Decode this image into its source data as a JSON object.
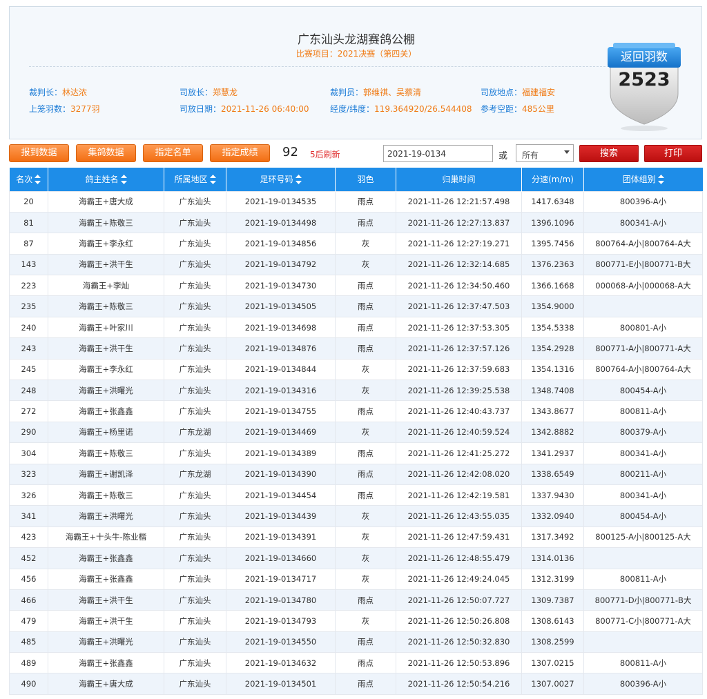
{
  "header": {
    "club_name": "广东汕头龙湖赛鸽公棚",
    "race_label": "比赛项目：",
    "race_value": "2021决赛（第四关）",
    "info": [
      {
        "label": "裁判长：",
        "value": "林达浓"
      },
      {
        "label": "司放长：",
        "value": "郑慧龙"
      },
      {
        "label": "裁判员：",
        "value": "郭维祺、吴蔡清"
      },
      {
        "label": "司放地点：",
        "value": "福建福安"
      },
      {
        "label": "上笼羽数：",
        "value": "3277羽"
      },
      {
        "label": "司放日期：",
        "value": "2021-11-26 06:40:00"
      },
      {
        "label": "经度/纬度：",
        "value": "119.364920/26.544408"
      },
      {
        "label": "参考空距：",
        "value": "485公里"
      }
    ],
    "badge": {
      "label": "返回羽数",
      "count": "2523"
    }
  },
  "toolbar": {
    "buttons": [
      "报到数据",
      "集鸽数据",
      "指定名单",
      "指定成绩"
    ],
    "count": "92",
    "refresh_text": "5后刷新",
    "search_value": "2021-19-0134",
    "or_label": "或",
    "select_value": "所有",
    "search_label": "搜索",
    "print_label": "打印"
  },
  "colors": {
    "header_blue": "#1e8de8",
    "orange": "#f07a14",
    "red_button": "#c81818"
  },
  "table": {
    "columns": [
      "名次",
      "鸽主姓名",
      "所属地区",
      "足环号码",
      "羽色",
      "归巢时间",
      "分速(m/m)",
      "团体组别"
    ],
    "rows": [
      [
        "20",
        "海霸王+唐大成",
        "广东汕头",
        "2021-19-0134535",
        "雨点",
        "2021-11-26 12:21:57.498",
        "1417.6348",
        "800396-A小"
      ],
      [
        "81",
        "海霸王+陈敬三",
        "广东汕头",
        "2021-19-0134498",
        "雨点",
        "2021-11-26 12:27:13.837",
        "1396.1096",
        "800341-A小"
      ],
      [
        "87",
        "海霸王+李永红",
        "广东汕头",
        "2021-19-0134856",
        "灰",
        "2021-11-26 12:27:19.271",
        "1395.7456",
        "800764-A小|800764-A大"
      ],
      [
        "143",
        "海霸王+洪干生",
        "广东汕头",
        "2021-19-0134792",
        "灰",
        "2021-11-26 12:32:14.685",
        "1376.2363",
        "800771-E小|800771-B大"
      ],
      [
        "223",
        "海霸王+李灿",
        "广东汕头",
        "2021-19-0134730",
        "雨点",
        "2021-11-26 12:34:50.460",
        "1366.1668",
        "000068-A小|000068-A大"
      ],
      [
        "235",
        "海霸王+陈敬三",
        "广东汕头",
        "2021-19-0134505",
        "雨点",
        "2021-11-26 12:37:47.503",
        "1354.9000",
        ""
      ],
      [
        "240",
        "海霸王+叶家川",
        "广东汕头",
        "2021-19-0134698",
        "雨点",
        "2021-11-26 12:37:53.305",
        "1354.5338",
        "800801-A小"
      ],
      [
        "243",
        "海霸王+洪干生",
        "广东汕头",
        "2021-19-0134876",
        "雨点",
        "2021-11-26 12:37:57.126",
        "1354.2928",
        "800771-A小|800771-A大"
      ],
      [
        "245",
        "海霸王+李永红",
        "广东汕头",
        "2021-19-0134844",
        "灰",
        "2021-11-26 12:37:59.683",
        "1354.1316",
        "800764-A小|800764-A大"
      ],
      [
        "248",
        "海霸王+洪曙光",
        "广东汕头",
        "2021-19-0134316",
        "灰",
        "2021-11-26 12:39:25.538",
        "1348.7408",
        "800454-A小"
      ],
      [
        "272",
        "海霸王+张鑫鑫",
        "广东汕头",
        "2021-19-0134755",
        "雨点",
        "2021-11-26 12:40:43.737",
        "1343.8677",
        "800811-A小"
      ],
      [
        "290",
        "海霸王+杨里诺",
        "广东龙湖",
        "2021-19-0134469",
        "灰",
        "2021-11-26 12:40:59.524",
        "1342.8882",
        "800379-A小"
      ],
      [
        "304",
        "海霸王+陈敬三",
        "广东汕头",
        "2021-19-0134389",
        "雨点",
        "2021-11-26 12:41:25.272",
        "1341.2937",
        "800341-A小"
      ],
      [
        "323",
        "海霸王+谢凯泽",
        "广东龙湖",
        "2021-19-0134390",
        "雨点",
        "2021-11-26 12:42:08.020",
        "1338.6549",
        "800211-A小"
      ],
      [
        "326",
        "海霸王+陈敬三",
        "广东汕头",
        "2021-19-0134454",
        "雨点",
        "2021-11-26 12:42:19.581",
        "1337.9430",
        "800341-A小"
      ],
      [
        "341",
        "海霸王+洪曙光",
        "广东汕头",
        "2021-19-0134439",
        "灰",
        "2021-11-26 12:43:55.035",
        "1332.0940",
        "800454-A小"
      ],
      [
        "423",
        "海霸王+十头牛-陈业楷",
        "广东汕头",
        "2021-19-0134391",
        "灰",
        "2021-11-26 12:47:59.431",
        "1317.3492",
        "800125-A小|800125-A大"
      ],
      [
        "452",
        "海霸王+张鑫鑫",
        "广东汕头",
        "2021-19-0134660",
        "灰",
        "2021-11-26 12:48:55.479",
        "1314.0136",
        ""
      ],
      [
        "456",
        "海霸王+张鑫鑫",
        "广东汕头",
        "2021-19-0134717",
        "灰",
        "2021-11-26 12:49:24.045",
        "1312.3199",
        "800811-A小"
      ],
      [
        "466",
        "海霸王+洪干生",
        "广东汕头",
        "2021-19-0134780",
        "雨点",
        "2021-11-26 12:50:07.727",
        "1309.7387",
        "800771-D小|800771-B大"
      ],
      [
        "479",
        "海霸王+洪干生",
        "广东汕头",
        "2021-19-0134793",
        "灰",
        "2021-11-26 12:50:26.808",
        "1308.6143",
        "800771-C小|800771-A大"
      ],
      [
        "485",
        "海霸王+洪曙光",
        "广东汕头",
        "2021-19-0134550",
        "雨点",
        "2021-11-26 12:50:32.830",
        "1308.2599",
        ""
      ],
      [
        "489",
        "海霸王+张鑫鑫",
        "广东汕头",
        "2021-19-0134632",
        "雨点",
        "2021-11-26 12:50:53.896",
        "1307.0215",
        "800811-A小"
      ],
      [
        "490",
        "海霸王+唐大成",
        "广东汕头",
        "2021-19-0134501",
        "雨点",
        "2021-11-26 12:50:54.216",
        "1307.0027",
        "800396-A小"
      ]
    ]
  }
}
